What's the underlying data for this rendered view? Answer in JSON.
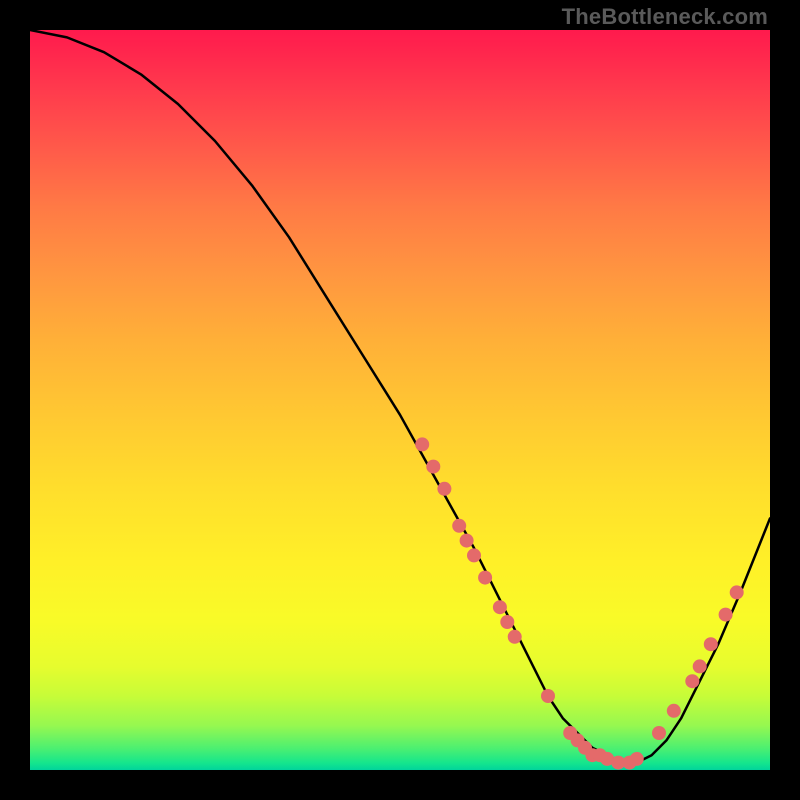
{
  "attribution": "TheBottleneck.com",
  "chart_data": {
    "type": "line",
    "title": "",
    "xlabel": "",
    "ylabel": "",
    "xlim": [
      0,
      100
    ],
    "ylim": [
      0,
      100
    ],
    "grid": false,
    "legend": false,
    "series": [
      {
        "name": "curve",
        "x": [
          0,
          5,
          10,
          15,
          20,
          25,
          30,
          35,
          40,
          45,
          50,
          55,
          60,
          62,
          65,
          68,
          70,
          72,
          74,
          76,
          78,
          80,
          82,
          84,
          86,
          88,
          90,
          93,
          96,
          100
        ],
        "y": [
          100,
          99,
          97,
          94,
          90,
          85,
          79,
          72,
          64,
          56,
          48,
          39,
          30,
          26,
          20,
          14,
          10,
          7,
          5,
          3,
          2,
          1,
          1,
          2,
          4,
          7,
          11,
          17,
          24,
          34
        ]
      }
    ],
    "markers": [
      {
        "name": "descending-cluster",
        "points": [
          {
            "x": 53,
            "y": 44
          },
          {
            "x": 54.5,
            "y": 41
          },
          {
            "x": 56,
            "y": 38
          },
          {
            "x": 58,
            "y": 33
          },
          {
            "x": 59,
            "y": 31
          },
          {
            "x": 60,
            "y": 29
          },
          {
            "x": 61.5,
            "y": 26
          },
          {
            "x": 63.5,
            "y": 22
          },
          {
            "x": 64.5,
            "y": 20
          },
          {
            "x": 65.5,
            "y": 18
          }
        ]
      },
      {
        "name": "valley-cluster",
        "points": [
          {
            "x": 70,
            "y": 10
          },
          {
            "x": 73,
            "y": 5
          },
          {
            "x": 74,
            "y": 4
          },
          {
            "x": 75,
            "y": 3
          },
          {
            "x": 76,
            "y": 2
          },
          {
            "x": 77,
            "y": 2
          },
          {
            "x": 78,
            "y": 1.5
          },
          {
            "x": 79.5,
            "y": 1
          },
          {
            "x": 81,
            "y": 1
          },
          {
            "x": 82,
            "y": 1.5
          }
        ]
      },
      {
        "name": "ascending-cluster",
        "points": [
          {
            "x": 85,
            "y": 5
          },
          {
            "x": 87,
            "y": 8
          },
          {
            "x": 89.5,
            "y": 12
          },
          {
            "x": 90.5,
            "y": 14
          },
          {
            "x": 92,
            "y": 17
          },
          {
            "x": 94,
            "y": 21
          },
          {
            "x": 95.5,
            "y": 24
          }
        ]
      }
    ],
    "colors": {
      "line": "#000000",
      "marker": "#e46a6a",
      "gradient_top": "#ff1a4d",
      "gradient_bottom": "#00d49c"
    }
  }
}
